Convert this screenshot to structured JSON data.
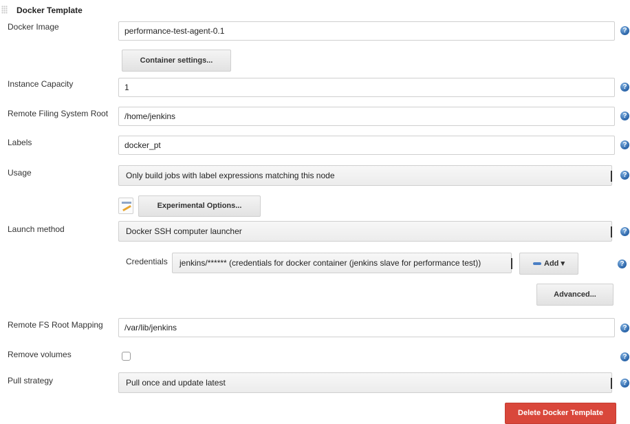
{
  "section": {
    "title": "Docker Template"
  },
  "docker_image": {
    "label": "Docker Image",
    "value": "performance-test-agent-0.1"
  },
  "container_settings_button": "Container settings...",
  "instance_capacity": {
    "label": "Instance Capacity",
    "value": "1"
  },
  "remote_fs_root": {
    "label": "Remote Filing System Root",
    "value": "/home/jenkins"
  },
  "labels": {
    "label": "Labels",
    "value": "docker_pt"
  },
  "usage": {
    "label": "Usage",
    "selected": "Only build jobs with label expressions matching this node"
  },
  "experimental_options_button": "Experimental Options...",
  "launch_method": {
    "label": "Launch method",
    "selected": "Docker SSH computer launcher"
  },
  "credentials": {
    "label": "Credentials",
    "selected": "jenkins/****** (credentials for docker container (jenkins slave for performance test))",
    "add_button": "Add",
    "add_caret": "▾"
  },
  "advanced_button": "Advanced...",
  "remote_fs_root_mapping": {
    "label": "Remote FS Root Mapping",
    "value": "/var/lib/jenkins"
  },
  "remove_volumes": {
    "label": "Remove volumes",
    "checked": false
  },
  "pull_strategy": {
    "label": "Pull strategy",
    "selected": "Pull once and update latest"
  },
  "delete_button": "Delete Docker Template",
  "colors": {
    "delete_button_bg": "#d9473b",
    "help_icon": "#2a64a8",
    "add_key_icon": "#4a7ec4"
  }
}
